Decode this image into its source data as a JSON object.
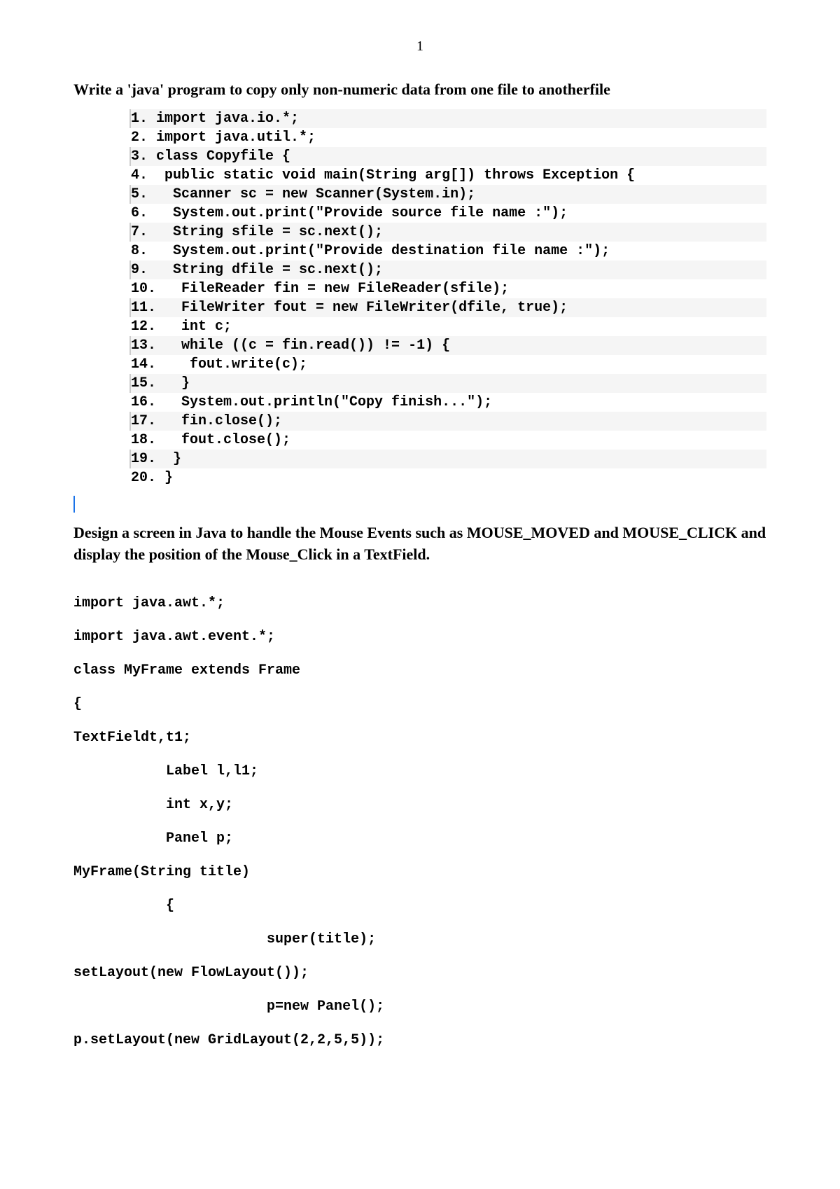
{
  "page_number": "1",
  "heading1": "Write a 'java' program to copy only non-numeric data from one file to anotherfile",
  "code1": {
    "lines": [
      "1. import java.io.*;",
      "2. import java.util.*;",
      "3. class Copyfile {",
      "4.  public static void main(String arg[]) throws Exception {  ",
      "5.   Scanner sc = new Scanner(System.in);",
      "6.   System.out.print(\"Provide source file name :\");",
      "7.   String sfile = sc.next();",
      "8.   System.out.print(\"Provide destination file name :\");",
      "9.   String dfile = sc.next();",
      "10.   FileReader fin = new FileReader(sfile);",
      "11.   FileWriter fout = new FileWriter(dfile, true);",
      "12.   int c;",
      "13.   while ((c = fin.read()) != -1) {",
      "14.    fout.write(c);",
      "15.   }",
      "16.   System.out.println(\"Copy finish...\");",
      "17.   fin.close();",
      "18.   fout.close();",
      "19.  }",
      "20. }"
    ]
  },
  "heading2": "Design a screen in Java to handle the Mouse Events such as MOUSE_MOVED and MOUSE_CLICK and display the position of the Mouse_Click in a TextField.",
  "code2": {
    "lines": [
      "import java.awt.*;",
      "import java.awt.event.*;",
      "class MyFrame extends Frame",
      "{",
      "TextFieldt,t1;",
      "           Label l,l1;",
      "           int x,y;",
      "           Panel p;",
      "MyFrame(String title)",
      "           {",
      "                       super(title);",
      "setLayout(new FlowLayout());",
      "                       p=new Panel();",
      "p.setLayout(new GridLayout(2,2,5,5));"
    ]
  }
}
